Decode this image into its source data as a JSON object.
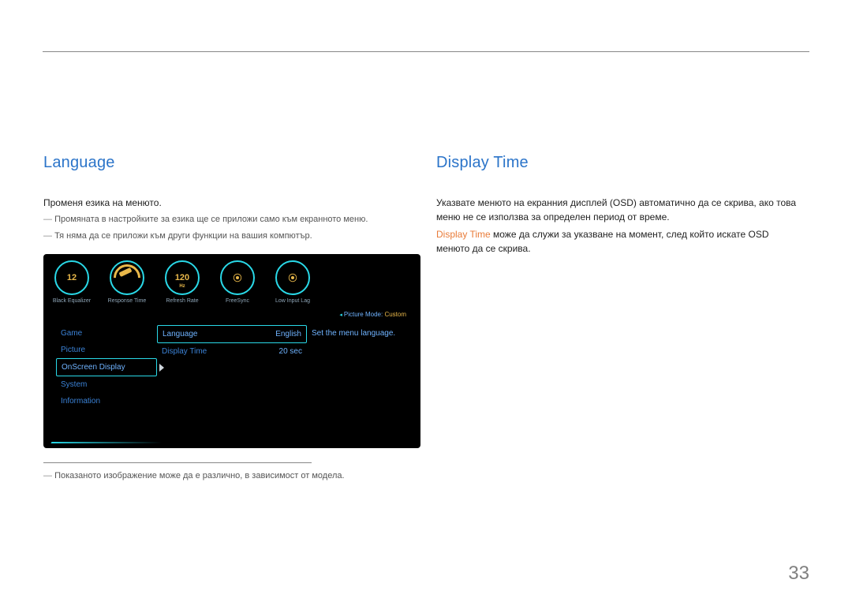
{
  "page_number": "33",
  "left": {
    "heading": "Language",
    "intro": "Променя езика на менюто.",
    "notes": [
      "Промяната в настройките за езика ще се приложи само към екранното меню.",
      "Тя няма да се приложи към други функции на вашия компютър."
    ],
    "footnote": "Показаното изображение може да е различно, в зависимост от модела."
  },
  "right": {
    "heading": "Display Time",
    "intro": "Указвате менюто на екранния дисплей (OSD) автоматично да се скрива, ако това меню не се използва за определен период от време.",
    "orange_label": "Display Time",
    "after_orange": " може да служи за указване на момент, след който искате OSD менюто да се скрива."
  },
  "osd": {
    "dials": [
      {
        "value": "12",
        "label": "Black Equalizer",
        "type": "num"
      },
      {
        "value": "",
        "label": "Response Time",
        "type": "gauge"
      },
      {
        "value": "120",
        "hz": "Hz",
        "label": "Refresh Rate",
        "type": "num"
      },
      {
        "value": "⦿",
        "label": "FreeSync",
        "type": "icon"
      },
      {
        "value": "⦿",
        "label": "Low Input Lag",
        "type": "icon"
      }
    ],
    "picture_mode_label": "Picture Mode: ",
    "picture_mode_value": "Custom",
    "side_menu": [
      {
        "label": "Game",
        "selected": false
      },
      {
        "label": "Picture",
        "selected": false
      },
      {
        "label": "OnScreen Display",
        "selected": true
      },
      {
        "label": "System",
        "selected": false
      },
      {
        "label": "Information",
        "selected": false
      }
    ],
    "sub_menu": [
      {
        "label": "Language",
        "value": "English",
        "selected": true
      },
      {
        "label": "Display Time",
        "value": "20 sec",
        "selected": false
      }
    ],
    "desc": "Set the menu language."
  }
}
